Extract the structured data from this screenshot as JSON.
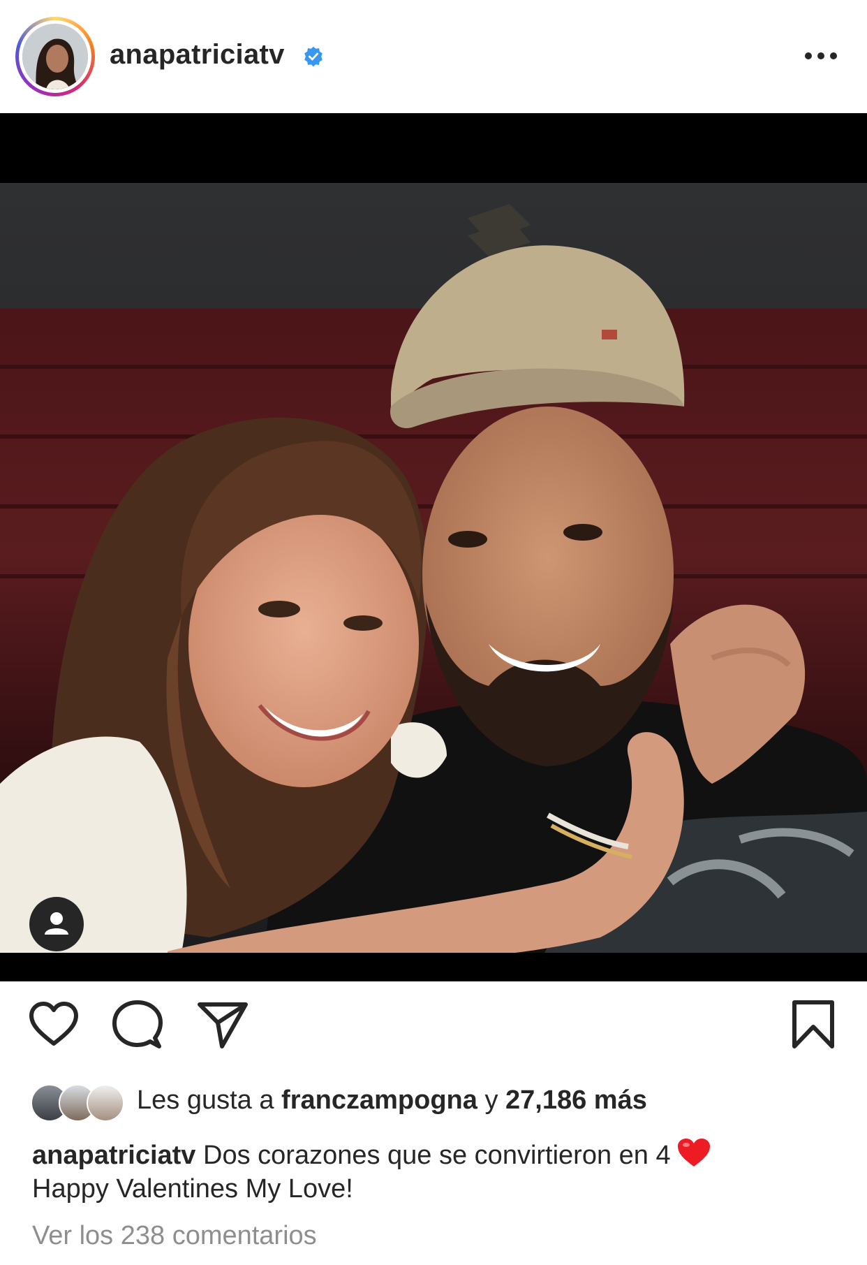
{
  "post": {
    "username": "anapatriciatv",
    "caption_line1": "Dos corazones que se convirtieron en 4",
    "caption_line2": "Happy Valentines My Love!",
    "caption_emoji": "red-heart"
  },
  "likes": {
    "prefix": "Les gusta a",
    "user": "franczampogna",
    "joiner": "y",
    "count": "27,186 más"
  },
  "comments": {
    "label": "Ver los 238 comentarios"
  },
  "icons": {
    "verified": "verified-badge-icon",
    "more": "more-options-icon",
    "like": "heart-icon",
    "comment": "comment-icon",
    "share": "send-icon",
    "save": "bookmark-icon",
    "tags": "user-tag-icon"
  },
  "colors": {
    "text": "#262626",
    "muted": "#8e8e8e",
    "verified": "#3897f0",
    "heart": "#ed4956"
  }
}
